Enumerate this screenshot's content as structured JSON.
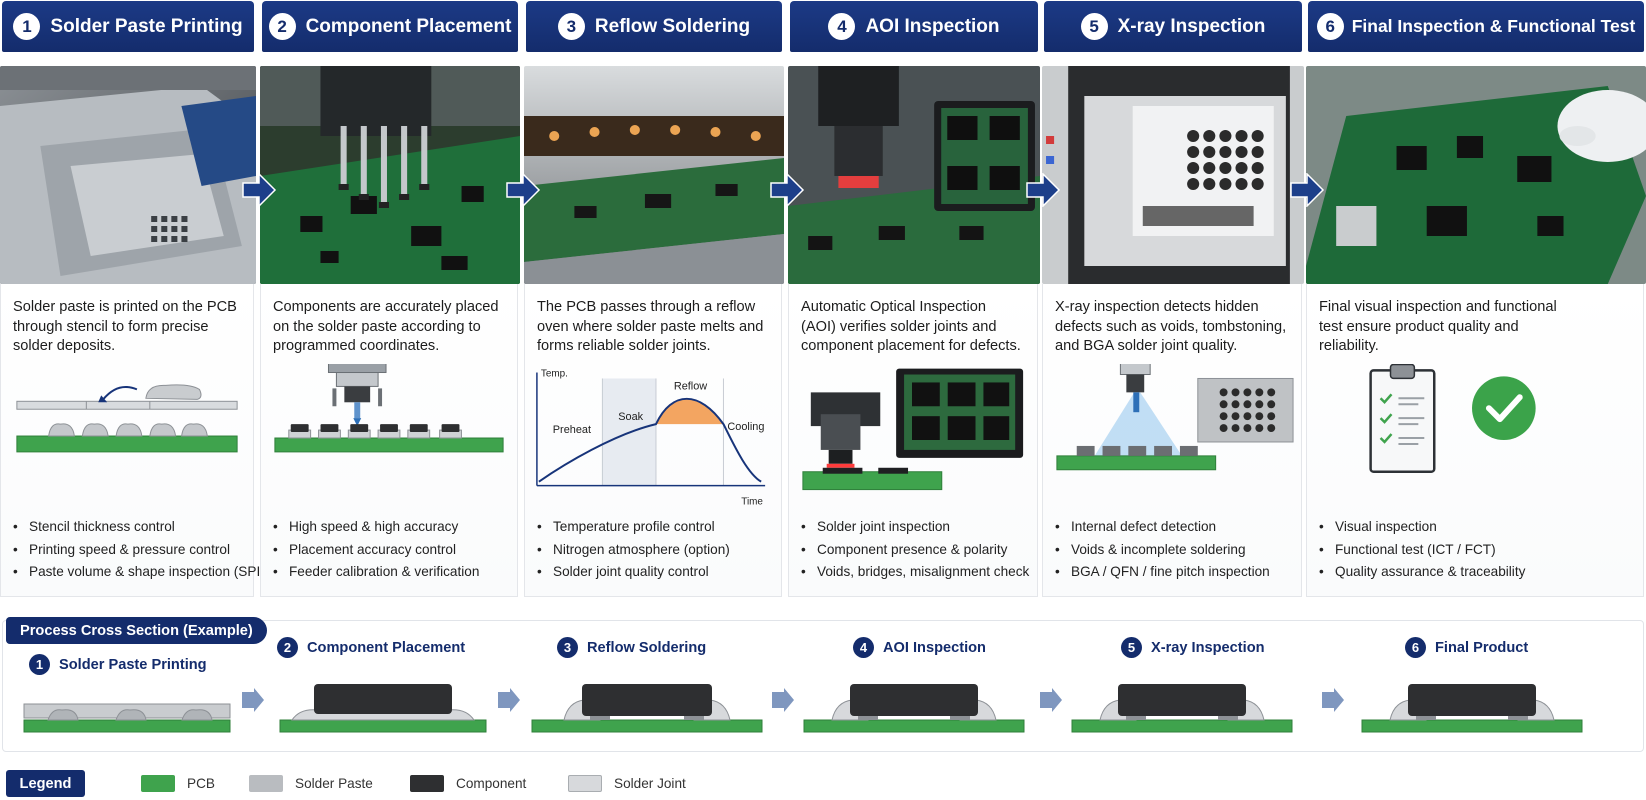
{
  "steps": [
    {
      "number": "1",
      "title": "Solder Paste Printing",
      "description": "Solder paste is printed on the PCB through stencil to form precise solder deposits.",
      "bullets": [
        "Stencil thickness control",
        "Printing speed & pressure control",
        "Paste volume & shape inspection (SPI)"
      ]
    },
    {
      "number": "2",
      "title": "Component Placement",
      "description": "Components are accurately placed on the solder paste according to programmed coordinates.",
      "bullets": [
        "High speed & high accuracy",
        "Placement accuracy control",
        "Feeder calibration & verification"
      ]
    },
    {
      "number": "3",
      "title": "Reflow Soldering",
      "description": "The PCB passes through a reflow oven where solder paste melts and forms reliable solder joints.",
      "bullets": [
        "Temperature profile control",
        "Nitrogen atmosphere (option)",
        "Solder joint quality control"
      ],
      "profile": {
        "y_axis": "Temp.",
        "x_axis": "Time",
        "zones": [
          "Preheat",
          "Soak",
          "Reflow",
          "Cooling"
        ]
      }
    },
    {
      "number": "4",
      "title": "AOI Inspection",
      "description": "Automatic Optical Inspection (AOI) verifies solder joints and component placement for defects.",
      "bullets": [
        "Solder joint inspection",
        "Component presence & polarity",
        "Voids, bridges, misalignment check"
      ]
    },
    {
      "number": "5",
      "title": "X-ray Inspection",
      "description": "X-ray inspection detects hidden defects such as voids, tombstoning, and BGA solder joint quality.",
      "bullets": [
        "Internal defect detection",
        "Voids & incomplete soldering",
        "BGA / QFN / fine pitch inspection"
      ]
    },
    {
      "number": "6",
      "title": "Final Inspection & Functional Test",
      "description": "Final visual inspection and functional test ensure product quality and reliability.",
      "bullets": [
        "Visual inspection",
        "Functional test (ICT / FCT)",
        "Quality assurance & traceability"
      ]
    }
  ],
  "cross_section": {
    "title": "Process Cross Section (Example)",
    "stages": [
      {
        "number": "1",
        "label": "Solder Paste Printing"
      },
      {
        "number": "2",
        "label": "Component Placement"
      },
      {
        "number": "3",
        "label": "Reflow Soldering"
      },
      {
        "number": "4",
        "label": "AOI Inspection"
      },
      {
        "number": "5",
        "label": "X-ray Inspection"
      },
      {
        "number": "6",
        "label": "Final Product"
      }
    ]
  },
  "legend": {
    "title": "Legend",
    "items": [
      {
        "label": "PCB",
        "color": "#3fa34d"
      },
      {
        "label": "Solder Paste",
        "color": "#b9bcc0"
      },
      {
        "label": "Component",
        "color": "#2e2f31"
      },
      {
        "label": "Solder Joint",
        "color": "#d7d9dc"
      }
    ]
  },
  "colors": {
    "header": "#142c6c",
    "pcb": "#3fa34d",
    "arrow": "#1d3f8a"
  }
}
